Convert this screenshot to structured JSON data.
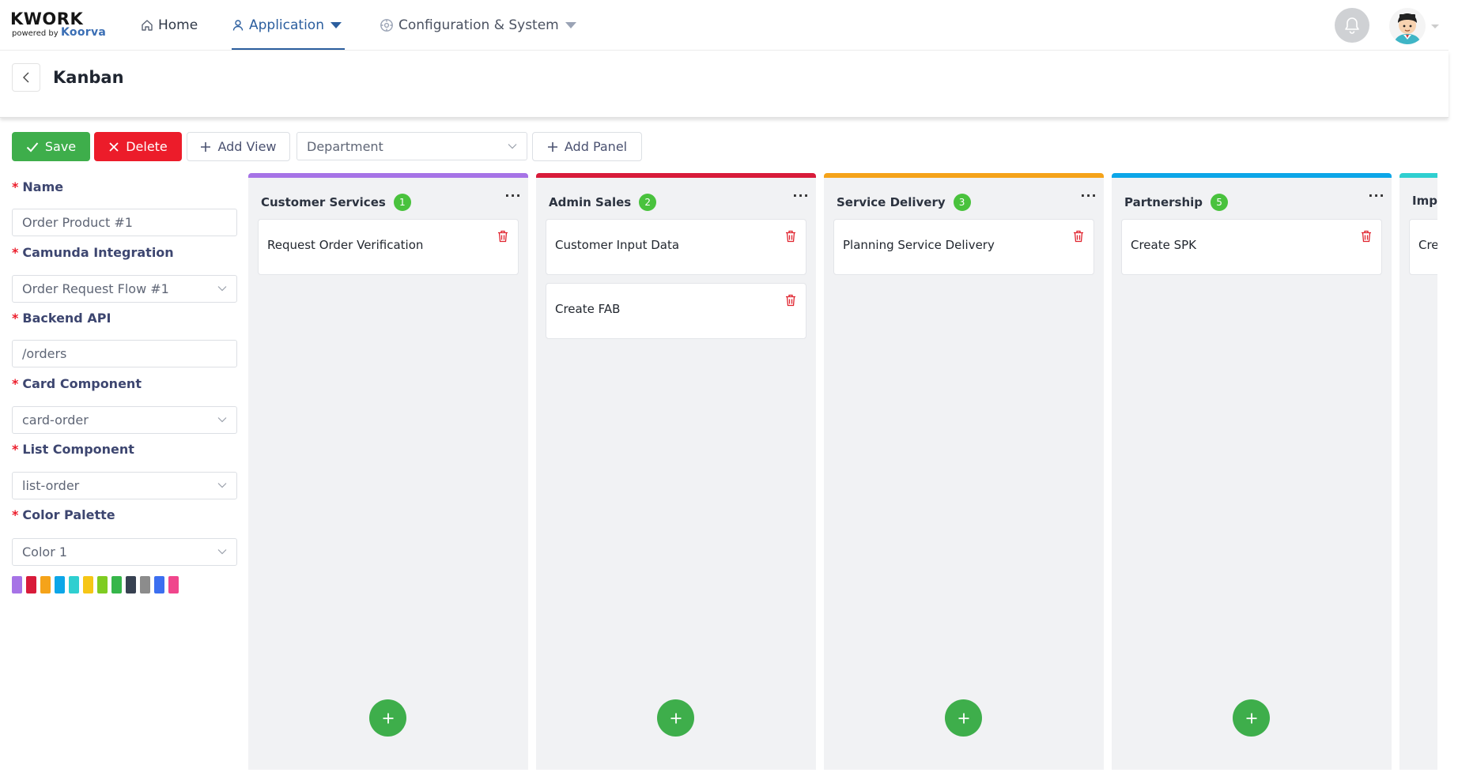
{
  "nav": {
    "logo_title": "KWORK",
    "logo_powered": "powered by",
    "logo_brand": "Koorva",
    "items": [
      {
        "label": "Home",
        "icon": "home-icon"
      },
      {
        "label": "Application",
        "icon": "user-icon"
      },
      {
        "label": "Configuration & System",
        "icon": "gear-icon"
      }
    ],
    "active_item": "Application"
  },
  "page": {
    "title": "Kanban"
  },
  "toolbar": {
    "save_label": "Save",
    "delete_label": "Delete",
    "add_view_label": "Add View",
    "department_select": "Department",
    "add_panel_label": "Add Panel"
  },
  "form": {
    "name_label": "Name",
    "name_value": "Order Product #1",
    "camunda_label": "Camunda Integration",
    "camunda_value": "Order Request Flow #1",
    "backend_label": "Backend API",
    "backend_value": "/orders",
    "card_label": "Card Component",
    "card_value": "card-order",
    "list_label": "List Component",
    "list_value": "list-order",
    "palette_label": "Color Palette",
    "palette_value": "Color 1",
    "palette_colors": [
      "#a673e6",
      "#d81b3a",
      "#f5a31a",
      "#0ca6e8",
      "#2fcfd0",
      "#f6c616",
      "#7fcc22",
      "#36b64a",
      "#374151",
      "#8c8c8c",
      "#3c6ff0",
      "#f0468c"
    ]
  },
  "board": {
    "columns": [
      {
        "title": "Customer Services",
        "count": "1",
        "color": "#a673e6",
        "cards": [
          "Request Order Verification"
        ]
      },
      {
        "title": "Admin Sales",
        "count": "2",
        "color": "#d81b3a",
        "cards": [
          "Customer Input Data",
          "Create FAB"
        ]
      },
      {
        "title": "Service Delivery",
        "count": "3",
        "color": "#f5a31a",
        "cards": [
          "Planning Service Delivery"
        ]
      },
      {
        "title": "Partnership",
        "count": "5",
        "color": "#0ca6e8",
        "cards": [
          "Create SPK"
        ]
      },
      {
        "title": "Impl",
        "count": "",
        "color": "#2fcfd0",
        "cards": [
          "Cre"
        ]
      }
    ]
  },
  "colors": {
    "accent": "#2b5e9e",
    "save": "#3eae4b",
    "delete": "#ec1c2a",
    "badge": "#49c23d"
  }
}
